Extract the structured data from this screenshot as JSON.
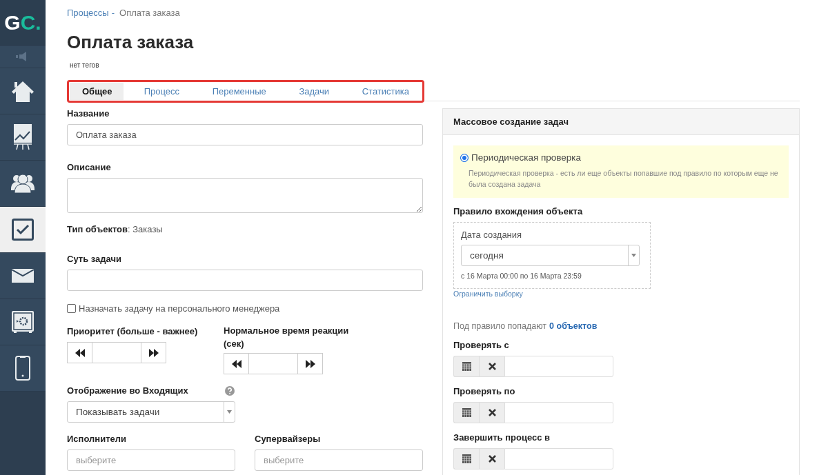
{
  "sidebar": {
    "logo": {
      "main": "G",
      "accent": "C."
    },
    "items": [
      {
        "kind": "speaker",
        "selected": false
      },
      {
        "kind": "home",
        "selected": false
      },
      {
        "kind": "chart",
        "selected": false
      },
      {
        "kind": "people",
        "selected": false
      },
      {
        "kind": "tasks",
        "selected": true
      },
      {
        "kind": "mail",
        "selected": false
      },
      {
        "kind": "safe",
        "selected": false
      },
      {
        "kind": "phone",
        "selected": false
      }
    ]
  },
  "breadcrumb": {
    "parent": "Процессы",
    "separator": "-",
    "current": "Оплата заказа"
  },
  "title": "Оплата заказа",
  "tags": "нет тегов",
  "tabs": [
    {
      "label": "Общее",
      "selected": true
    },
    {
      "label": "Процесс",
      "selected": false
    },
    {
      "label": "Переменные",
      "selected": false
    },
    {
      "label": "Задачи",
      "selected": false
    },
    {
      "label": "Статистика",
      "selected": false
    }
  ],
  "form": {
    "name": {
      "label": "Название",
      "value": "Оплата заказа"
    },
    "description": {
      "label": "Описание"
    },
    "object_type": "**Тип объектов**: Заказы",
    "essence": {
      "label": "Суть задачи"
    },
    "personal_manager": {
      "label": "Назначать задачу на персонального менеджера",
      "checked": false
    },
    "priority": {
      "label": "Приоритет (больше - важнее)"
    },
    "reaction_time": {
      "label": "Нормальное время реакции (сек)"
    },
    "inbox_display": {
      "label": "Отображение во Входящих",
      "value": "Показывать задачи"
    },
    "executors": {
      "label": "Исполнители",
      "placeholder": "выберите"
    },
    "supervisors": {
      "label": "Супервайзеры",
      "placeholder": "выберите"
    }
  },
  "panel": {
    "title": "Массовое создание задач",
    "option": {
      "label": "Периодическая проверка",
      "selected": true,
      "description": "Периодическая проверка - есть ли еще объекты попавшие под правило по которым еще не была создана задача"
    },
    "rule_title": "Правило вхождения объекта",
    "rule": {
      "label": "Дата создания",
      "value": "сегодня",
      "range": "с 16 Марта 00:00 по 16 Марта 23:59"
    },
    "limit_link": "Ограничить выборку",
    "count": {
      "text": "Под правило попадают",
      "link": "0 объектов"
    },
    "date_fields": [
      {
        "label": "Проверять с"
      },
      {
        "label": "Проверять по"
      },
      {
        "label": "Завершить процесс в"
      }
    ]
  }
}
